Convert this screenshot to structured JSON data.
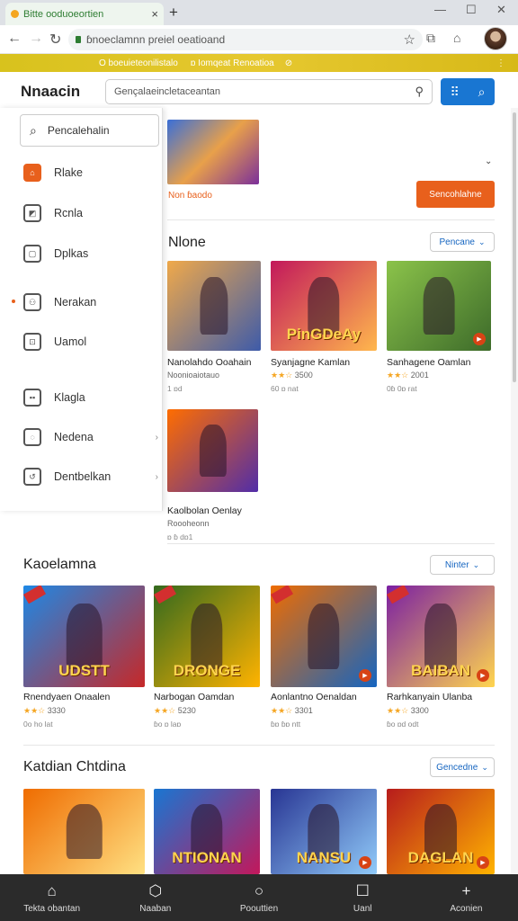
{
  "browser": {
    "tab_title": "Bitte ooduoeortien",
    "tab_close": "×",
    "new_tab": "+",
    "window_controls": [
      "—",
      "☐",
      "✕"
    ],
    "address": "ɓnoeclamnn pɾeiel oeatioand",
    "bookmarks": [
      "O boeuieteonilistalo",
      "ɒ Iomqeat Renoatioa",
      "⊘"
    ],
    "menu": "⋮"
  },
  "header": {
    "logo": "Nnaacin",
    "search_placeholder": "Gençalaeincletaceantan"
  },
  "sidebar": {
    "search_label": "Pencalehalin",
    "items": [
      {
        "label": "Rlake",
        "icon": "store-icon",
        "active": true
      },
      {
        "label": "Rcnla",
        "icon": "tag-icon"
      },
      {
        "label": "Dplkas",
        "icon": "square-icon"
      },
      {
        "label": "Nerakan",
        "icon": "gamepad-icon"
      },
      {
        "label": "Uamol",
        "icon": "briefcase-icon"
      },
      {
        "label": "Klagla",
        "icon": "grid-icon"
      },
      {
        "label": "Nedena",
        "icon": "folder-icon"
      },
      {
        "label": "Dentbelkan",
        "icon": "history-icon"
      }
    ]
  },
  "promo": {
    "caption": "Non ɓaodo",
    "button": "Sencohlahne"
  },
  "sections": [
    {
      "title": "Nlone",
      "dropdown": "Pencane",
      "cards": [
        {
          "title": "Nanolahdo Ooahain",
          "sub": "Noonioaiotauo",
          "meta": "1 ɒd",
          "colors": [
            "#f0a94a",
            "#3e5ba9"
          ]
        },
        {
          "title": "Syanjagne Kamlan",
          "sub": "3500",
          "meta": "60 ɒ nat",
          "word": "PinGDeAy",
          "colors": [
            "#c2185b",
            "#ffb74d"
          ]
        },
        {
          "title": "Sanhagene Oamlan",
          "sub": "2001",
          "meta": "0ɓ 0ɒ rat",
          "colors": [
            "#8bc34a",
            "#3d6b2a"
          ]
        },
        {
          "title": "Kaolbolan Oenlay",
          "sub": "Roooheonn",
          "meta": "ɒ ɓ dɒ1",
          "colors": [
            "#ff6d00",
            "#512da8"
          ]
        }
      ]
    },
    {
      "title": "Kaoelamna",
      "dropdown": "Ninter",
      "cards": [
        {
          "title": "Rnendyaen Onaalen",
          "sub": "3330",
          "meta": "0o ho lat",
          "word": "UDSTT",
          "colors": [
            "#1e88e5",
            "#c62828"
          ]
        },
        {
          "title": "Narbogan Oamdan",
          "sub": "5230",
          "meta": "ɓo ɒ laɒ",
          "word": "DRONGE",
          "colors": [
            "#33691e",
            "#ffb300"
          ]
        },
        {
          "title": "Aonlantno Oenaldan",
          "sub": "3301",
          "meta": "ɓɒ ɓɒ ntt",
          "colors": [
            "#ef6c00",
            "#1565c0"
          ]
        },
        {
          "title": "Rarhkanyain Ulanba",
          "sub": "3300",
          "meta": "ɓo ɒd odt",
          "word": "BAIBAN",
          "colors": [
            "#7b1fa2",
            "#ffd54f"
          ]
        }
      ]
    },
    {
      "title": "Katdian Chtdina",
      "dropdown": "Gencedne",
      "cards": [
        {
          "title": "",
          "sub": "",
          "meta": "",
          "colors": [
            "#ef6c00",
            "#ffe082"
          ]
        },
        {
          "title": "",
          "sub": "",
          "meta": "",
          "word": "NTIONAN",
          "colors": [
            "#1976d2",
            "#c2185b"
          ]
        },
        {
          "title": "",
          "sub": "",
          "meta": "",
          "word": "NANSU",
          "colors": [
            "#283593",
            "#90caf9"
          ]
        },
        {
          "title": "",
          "sub": "",
          "meta": "",
          "word": "DAGLAN",
          "colors": [
            "#b71c1c",
            "#ffb300"
          ]
        }
      ]
    }
  ],
  "bottom_nav": [
    {
      "label": "Tekta obantan",
      "icon": "home-icon"
    },
    {
      "label": "Naaban",
      "icon": "chat-icon"
    },
    {
      "label": "Poouttien",
      "icon": "circle-icon"
    },
    {
      "label": "Uanl",
      "icon": "square-icon"
    },
    {
      "label": "Aconien",
      "icon": "plus-icon"
    }
  ]
}
